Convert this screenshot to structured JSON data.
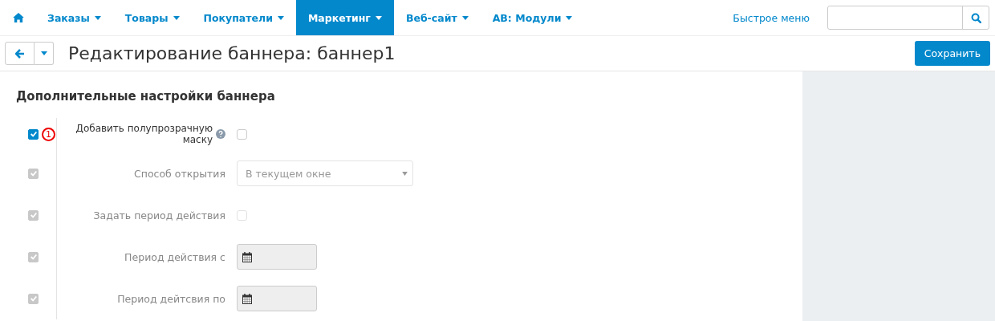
{
  "nav": {
    "items": [
      {
        "label": "Заказы",
        "selected": false
      },
      {
        "label": "Товары",
        "selected": false
      },
      {
        "label": "Покупатели",
        "selected": false
      },
      {
        "label": "Маркетинг",
        "selected": true
      },
      {
        "label": "Веб-сайт",
        "selected": false
      },
      {
        "label": "AB: Модули",
        "selected": false
      }
    ],
    "quick_menu": "Быстрое меню"
  },
  "header": {
    "title": "Редактирование баннера: баннер1",
    "save_button": "Сохранить"
  },
  "section": {
    "title": "Дополнительные настройки баннера",
    "annotation": "1",
    "rows": [
      {
        "kind": "checkbox",
        "label": "Добавить полупрозрачную маску",
        "help": true,
        "override_checked": true,
        "disabled": false,
        "checked": false
      },
      {
        "kind": "select",
        "label": "Способ открытия",
        "value": "В текущем окне",
        "override_checked": true,
        "disabled": true
      },
      {
        "kind": "checkbox",
        "label": "Задать период действия",
        "help": false,
        "override_checked": true,
        "disabled": true,
        "checked": false
      },
      {
        "kind": "date",
        "label": "Период действия с",
        "override_checked": true,
        "disabled": true
      },
      {
        "kind": "date",
        "label": "Период дейтсвия по",
        "override_checked": true,
        "disabled": true
      }
    ]
  }
}
